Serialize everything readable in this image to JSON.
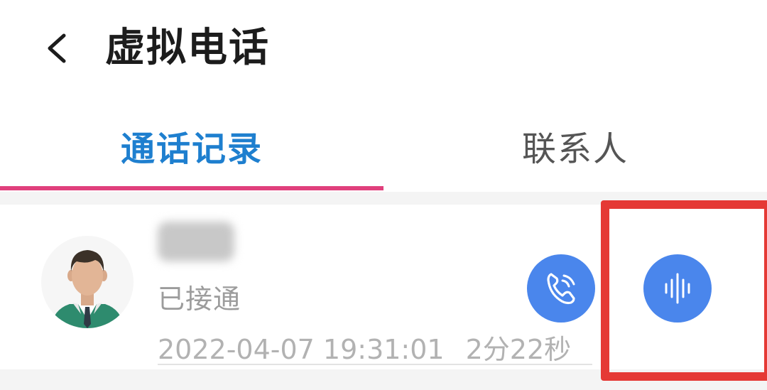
{
  "header": {
    "title": "虚拟电话",
    "back_icon": "chevron-left-icon"
  },
  "tabs": [
    {
      "label": "通话记录",
      "active": true
    },
    {
      "label": "联系人",
      "active": false
    }
  ],
  "record": {
    "status": "已接通",
    "datetime": "2022-04-07 19:31:01",
    "duration": "2分22秒",
    "avatar_icon": "male-avatar-icon",
    "call_button_icon": "phone-icon",
    "recording_button_icon": "audio-waveform-icon"
  },
  "colors": {
    "accent_blue": "#1e7fcf",
    "button_blue": "#4a86ec",
    "tab_indicator": "#e0407c",
    "highlight_red": "#e53935"
  }
}
